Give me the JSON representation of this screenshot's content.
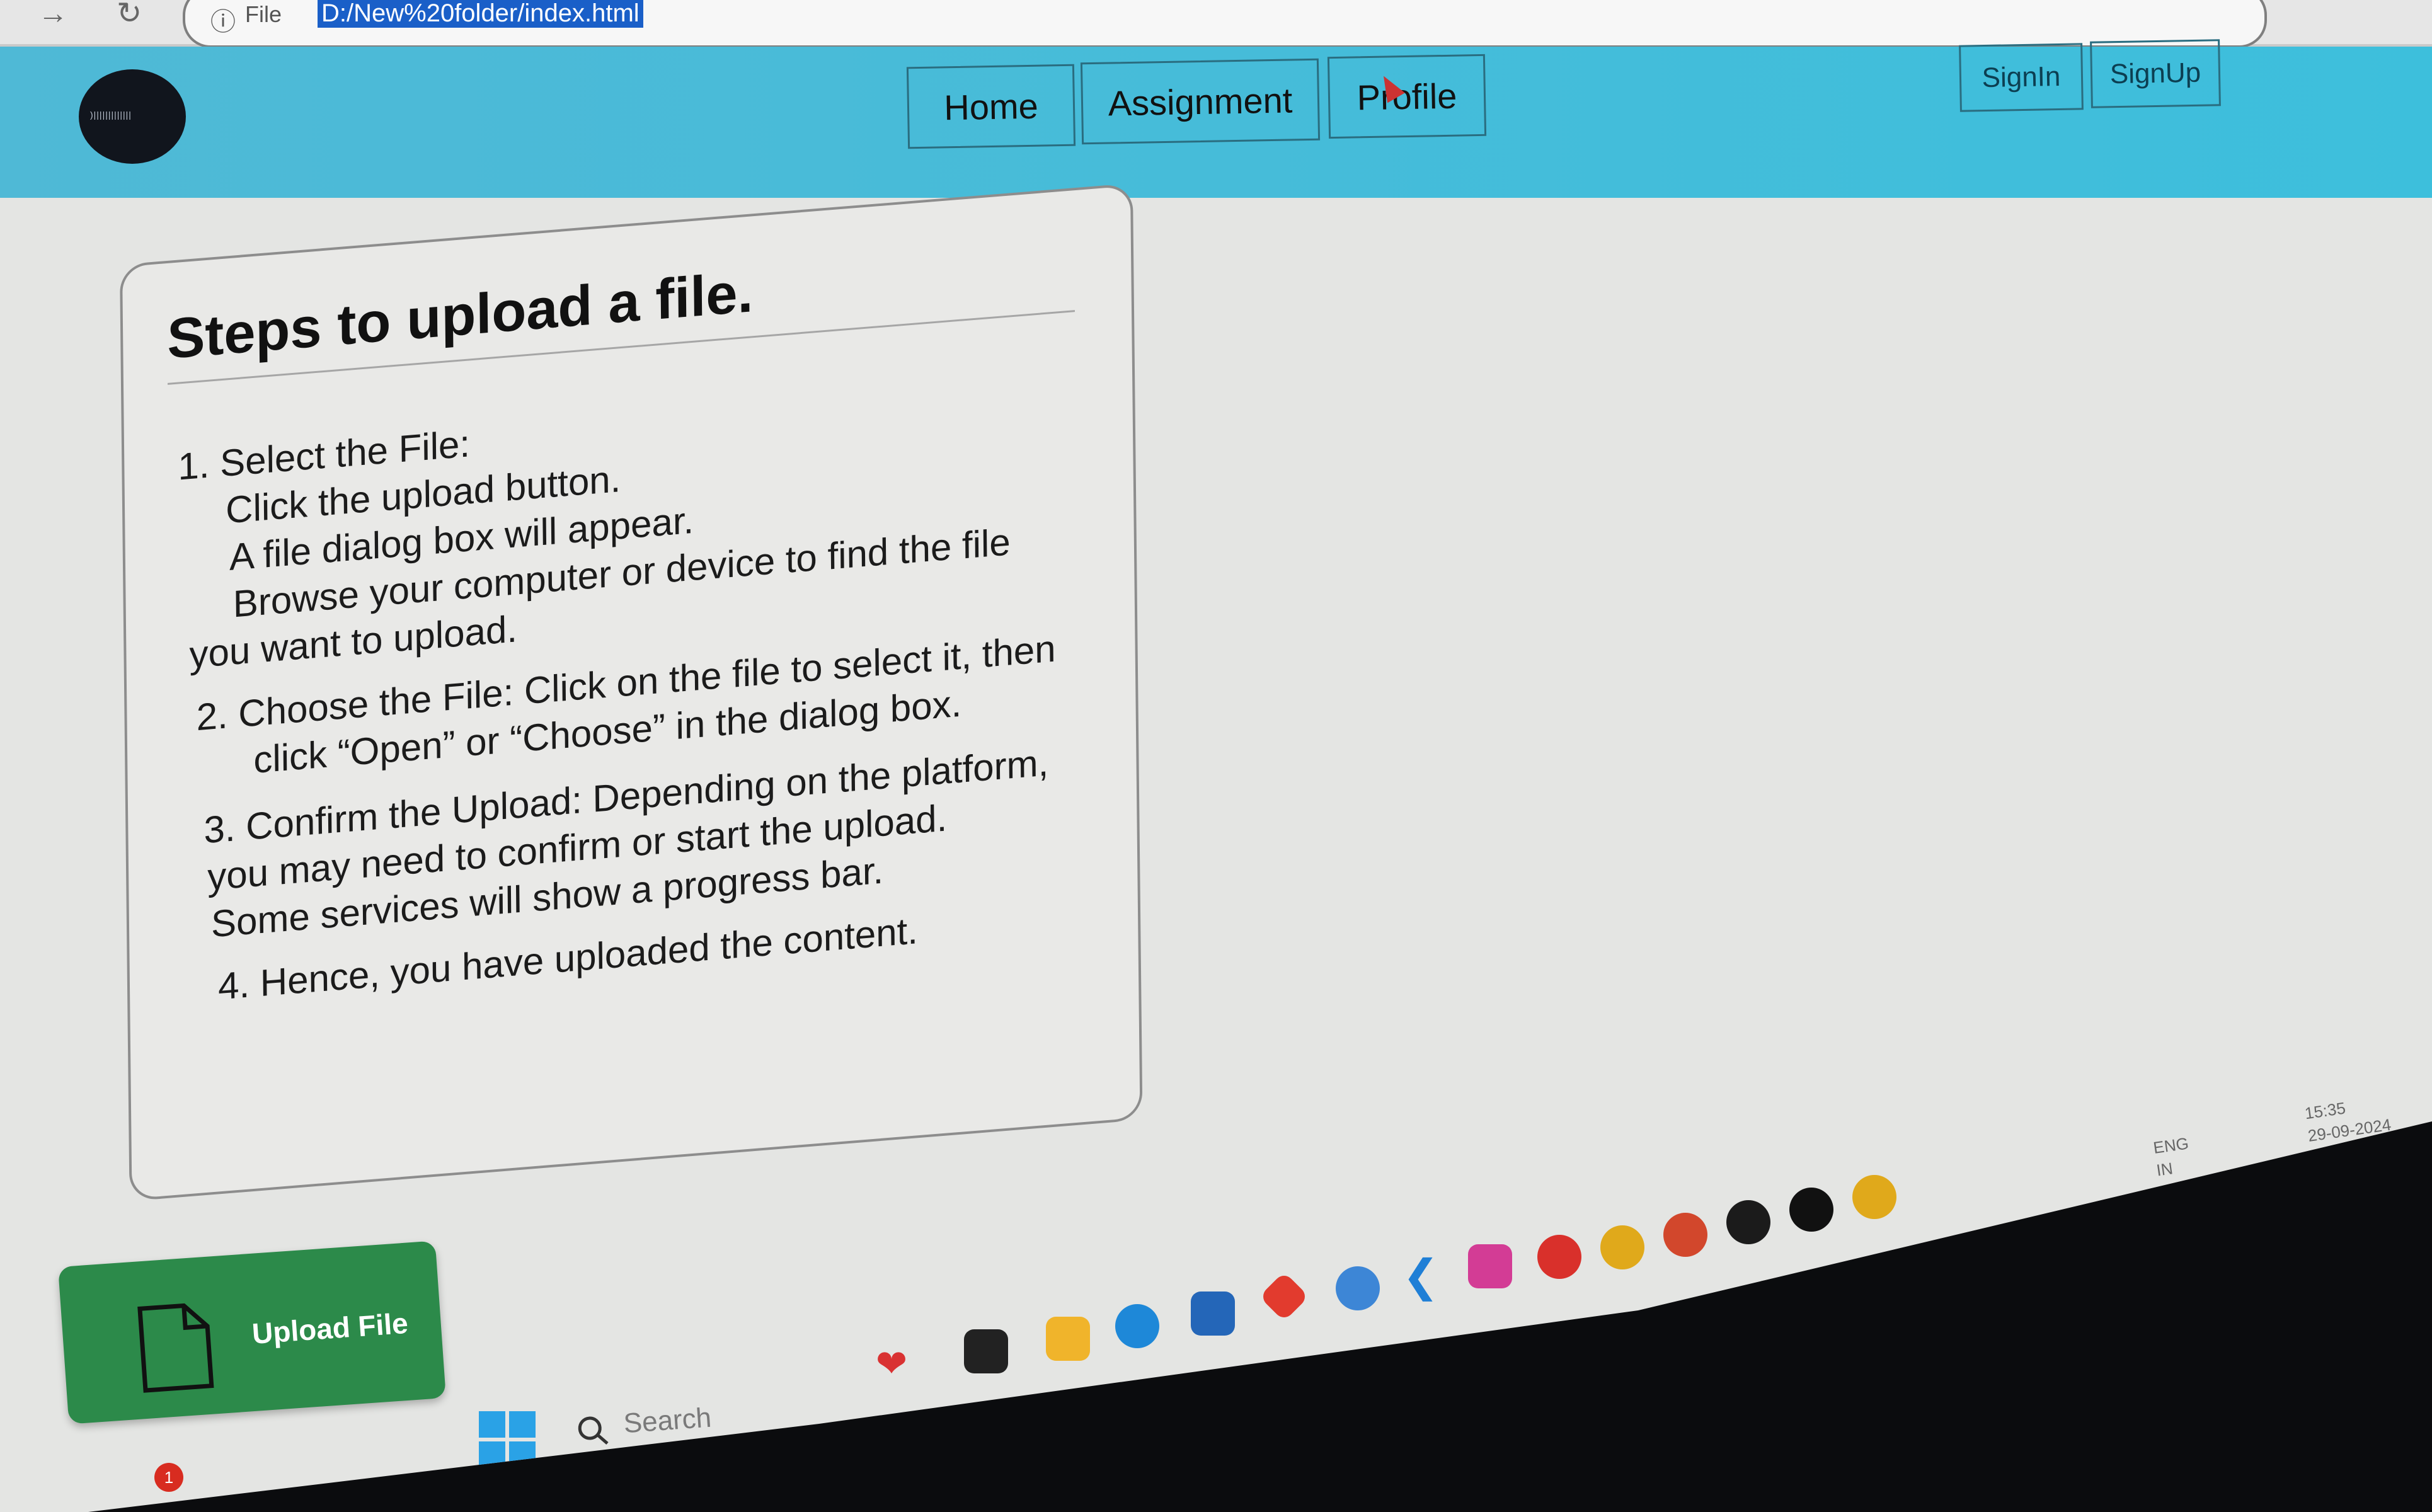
{
  "browser": {
    "back_icon": "back-arrow-icon",
    "reload_icon": "reload-icon",
    "file_label": "File",
    "url": "D:/New%20folder/index.html"
  },
  "header": {
    "logo_text": ")|||||||||||||",
    "nav": [
      {
        "label": "Home"
      },
      {
        "label": "Assignment"
      },
      {
        "label": "Profile"
      }
    ],
    "auth": [
      {
        "label": "SignIn"
      },
      {
        "label": "SignUp"
      }
    ]
  },
  "card": {
    "title": "Steps to upload a file.",
    "lines": [
      "1. Select the File:",
      "Click the upload button.",
      "A file dialog box will appear.",
      "Browse your computer or device to find the file",
      "you     want to upload.",
      "2. Choose the File: Click on the file to select it, then",
      "click “Open” or “Choose” in the dialog box.",
      "3. Confirm the Upload: Depending on the platform,",
      "you     may need to confirm or start the upload.",
      "Some     services will show a progress bar.",
      "4. Hence, you have uploaded the content."
    ]
  },
  "upload_button": {
    "label": "Upload File"
  },
  "taskbar": {
    "search_placeholder": "Search",
    "notification_count": "1",
    "language": "ENG",
    "region": "IN",
    "time": "15:35",
    "date": "29-09-2024"
  },
  "colors": {
    "header": "#3dbfdc",
    "upload_button": "#2c8a4a",
    "url_highlight": "#1a5fc8"
  }
}
